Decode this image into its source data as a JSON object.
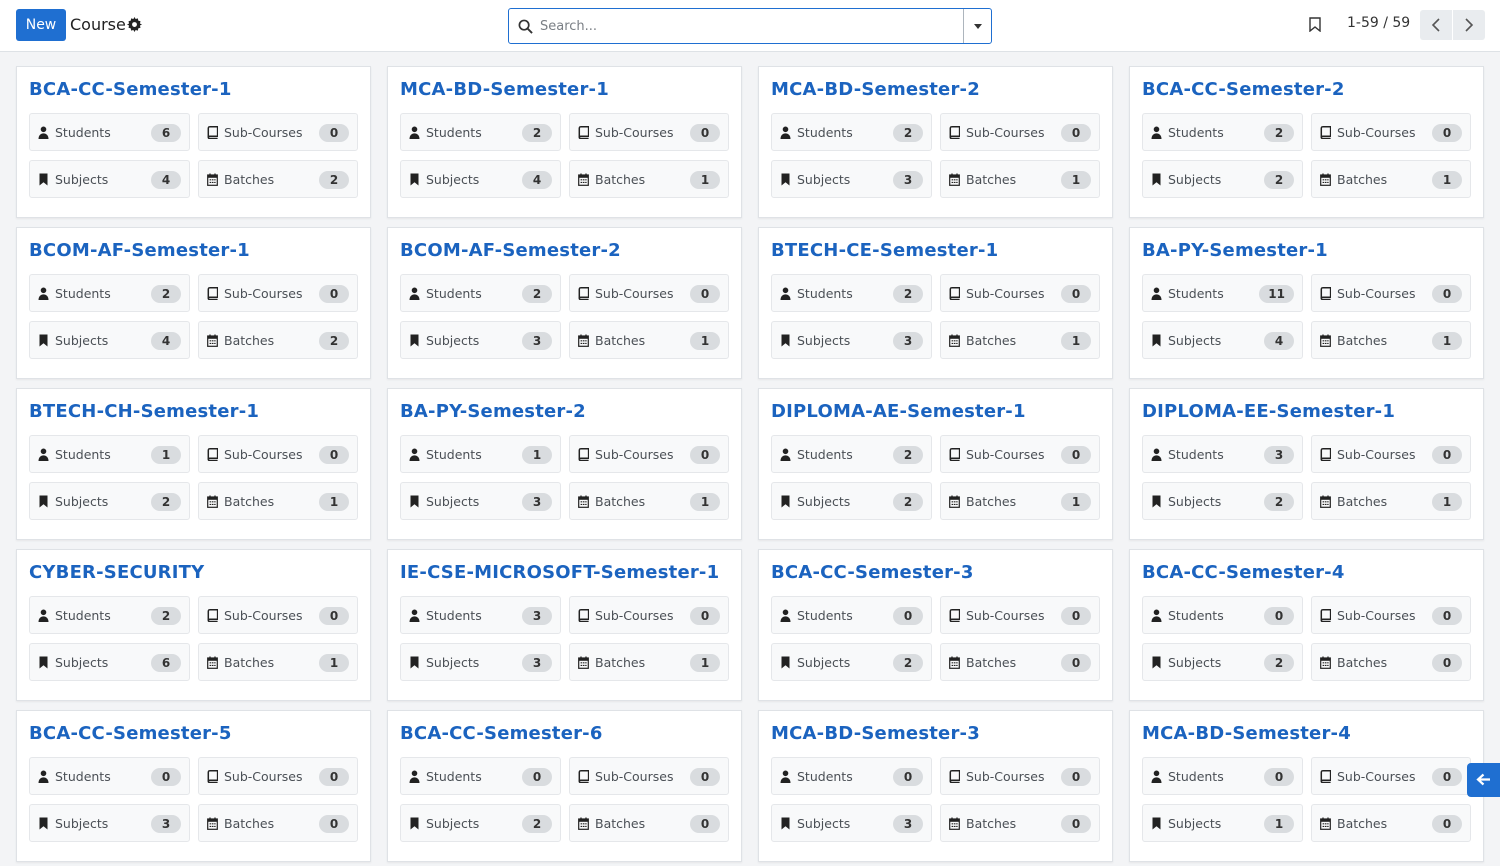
{
  "header": {
    "new_label": "New",
    "breadcrumb": "Course",
    "search_placeholder": "Search...",
    "pager": "1-59 / 59"
  },
  "labels": {
    "students": "Students",
    "subcourses": "Sub-Courses",
    "subjects": "Subjects",
    "batches": "Batches"
  },
  "colors": {
    "accent": "#1f6fd1",
    "title": "#1b63bf"
  },
  "courses": [
    {
      "name": "BCA-CC-Semester-1",
      "students": "6",
      "subcourses": "0",
      "subjects": "4",
      "batches": "2"
    },
    {
      "name": "MCA-BD-Semester-1",
      "students": "2",
      "subcourses": "0",
      "subjects": "4",
      "batches": "1"
    },
    {
      "name": "MCA-BD-Semester-2",
      "students": "2",
      "subcourses": "0",
      "subjects": "3",
      "batches": "1"
    },
    {
      "name": "BCA-CC-Semester-2",
      "students": "2",
      "subcourses": "0",
      "subjects": "2",
      "batches": "1"
    },
    {
      "name": "BCOM-AF-Semester-1",
      "students": "2",
      "subcourses": "0",
      "subjects": "4",
      "batches": "2"
    },
    {
      "name": "BCOM-AF-Semester-2",
      "students": "2",
      "subcourses": "0",
      "subjects": "3",
      "batches": "1"
    },
    {
      "name": "BTECH-CE-Semester-1",
      "students": "2",
      "subcourses": "0",
      "subjects": "3",
      "batches": "1"
    },
    {
      "name": "BA-PY-Semester-1",
      "students": "11",
      "subcourses": "0",
      "subjects": "4",
      "batches": "1"
    },
    {
      "name": "BTECH-CH-Semester-1",
      "students": "1",
      "subcourses": "0",
      "subjects": "2",
      "batches": "1"
    },
    {
      "name": "BA-PY-Semester-2",
      "students": "1",
      "subcourses": "0",
      "subjects": "3",
      "batches": "1"
    },
    {
      "name": "DIPLOMA-AE-Semester-1",
      "students": "2",
      "subcourses": "0",
      "subjects": "2",
      "batches": "1"
    },
    {
      "name": "DIPLOMA-EE-Semester-1",
      "students": "3",
      "subcourses": "0",
      "subjects": "2",
      "batches": "1"
    },
    {
      "name": "CYBER-SECURITY",
      "students": "2",
      "subcourses": "0",
      "subjects": "6",
      "batches": "1"
    },
    {
      "name": "IE-CSE-MICROSOFT-Semester-1",
      "students": "3",
      "subcourses": "0",
      "subjects": "3",
      "batches": "1"
    },
    {
      "name": "BCA-CC-Semester-3",
      "students": "0",
      "subcourses": "0",
      "subjects": "2",
      "batches": "0"
    },
    {
      "name": "BCA-CC-Semester-4",
      "students": "0",
      "subcourses": "0",
      "subjects": "2",
      "batches": "0"
    },
    {
      "name": "BCA-CC-Semester-5",
      "students": "0",
      "subcourses": "0",
      "subjects": "3",
      "batches": "0"
    },
    {
      "name": "BCA-CC-Semester-6",
      "students": "0",
      "subcourses": "0",
      "subjects": "2",
      "batches": "0"
    },
    {
      "name": "MCA-BD-Semester-3",
      "students": "0",
      "subcourses": "0",
      "subjects": "3",
      "batches": "0"
    },
    {
      "name": "MCA-BD-Semester-4",
      "students": "0",
      "subcourses": "0",
      "subjects": "1",
      "batches": "0"
    }
  ]
}
